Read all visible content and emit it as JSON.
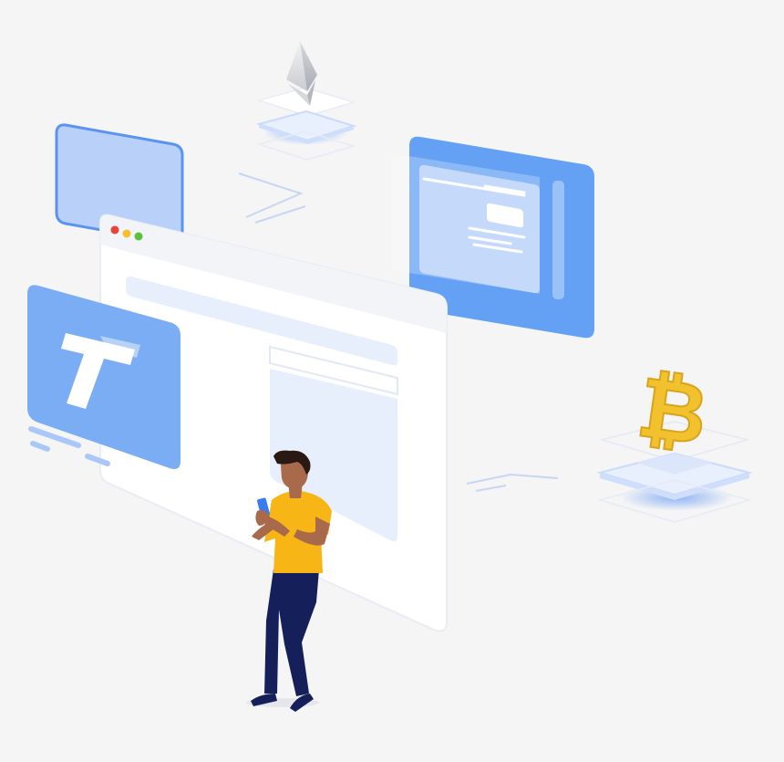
{
  "illustration": {
    "browser_window": {
      "traffic_light_colors": [
        "#e8443a",
        "#f5c02c",
        "#5ac13b"
      ]
    },
    "logo_card": {
      "glyph": "T"
    },
    "crypto": [
      {
        "name": "ethereum",
        "icon": "ethereum-icon"
      },
      {
        "name": "bitcoin",
        "icon": "bitcoin-icon",
        "glyph": "₿"
      }
    ],
    "colors": {
      "background": "#f5f5f6",
      "primary_blue": "#64a0f4",
      "light_blue": "#a9c8f7",
      "pale_blue": "#e8effc",
      "shirt_yellow": "#f7b516",
      "pants_navy": "#15205b",
      "coin_gold": "#f2c12e"
    }
  }
}
